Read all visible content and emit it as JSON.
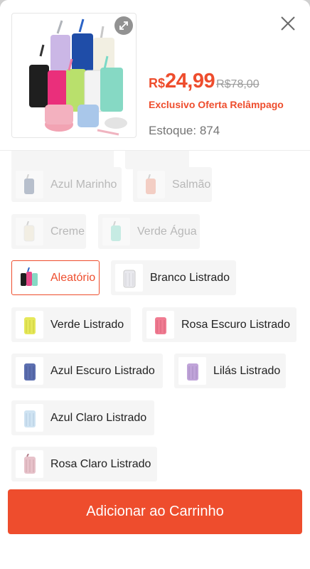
{
  "product": {
    "currency": "R$",
    "price": "24,99",
    "old_price": "R$78,00",
    "flash_label": "Exclusivo Oferta Relâmpago",
    "stock_label": "Estoque: 874"
  },
  "icons": {
    "expand": "expand-icon",
    "close": "close-icon"
  },
  "colors": {
    "accent": "#ee4d2d",
    "option_bg": "#f5f5f5"
  },
  "options": [
    {
      "label": "",
      "state": "disabled"
    },
    {
      "label": "",
      "state": "disabled"
    },
    {
      "label": "Azul Marinho",
      "state": "disabled",
      "swatch": "#6d7f9c"
    },
    {
      "label": "Salmão",
      "state": "disabled",
      "swatch": "#f2a08a"
    },
    {
      "label": "Creme",
      "state": "disabled",
      "swatch": "#efe6cf"
    },
    {
      "label": "Verde Água",
      "state": "disabled",
      "swatch": "#8fe0cf"
    },
    {
      "label": "Aleatório",
      "state": "selected",
      "swatch": "#e84a8a"
    },
    {
      "label": "Branco Listrado",
      "state": "normal",
      "swatch": "#e9e9ee"
    },
    {
      "label": "Verde Listrado",
      "state": "normal",
      "swatch": "#e6e85a"
    },
    {
      "label": "Rosa Escuro Listrado",
      "state": "normal",
      "swatch": "#f07c92"
    },
    {
      "label": "Azul Escuro Listrado",
      "state": "normal",
      "swatch": "#5c6fb0"
    },
    {
      "label": "Lilás Listrado",
      "state": "normal",
      "swatch": "#c0a4d9"
    },
    {
      "label": "Azul Claro Listrado",
      "state": "normal",
      "swatch": "#cfe3f2"
    },
    {
      "label": "Rosa Claro Listrado",
      "state": "normal",
      "swatch": "#e7c2ca"
    }
  ],
  "footer": {
    "add_to_cart": "Adicionar ao Carrinho"
  }
}
